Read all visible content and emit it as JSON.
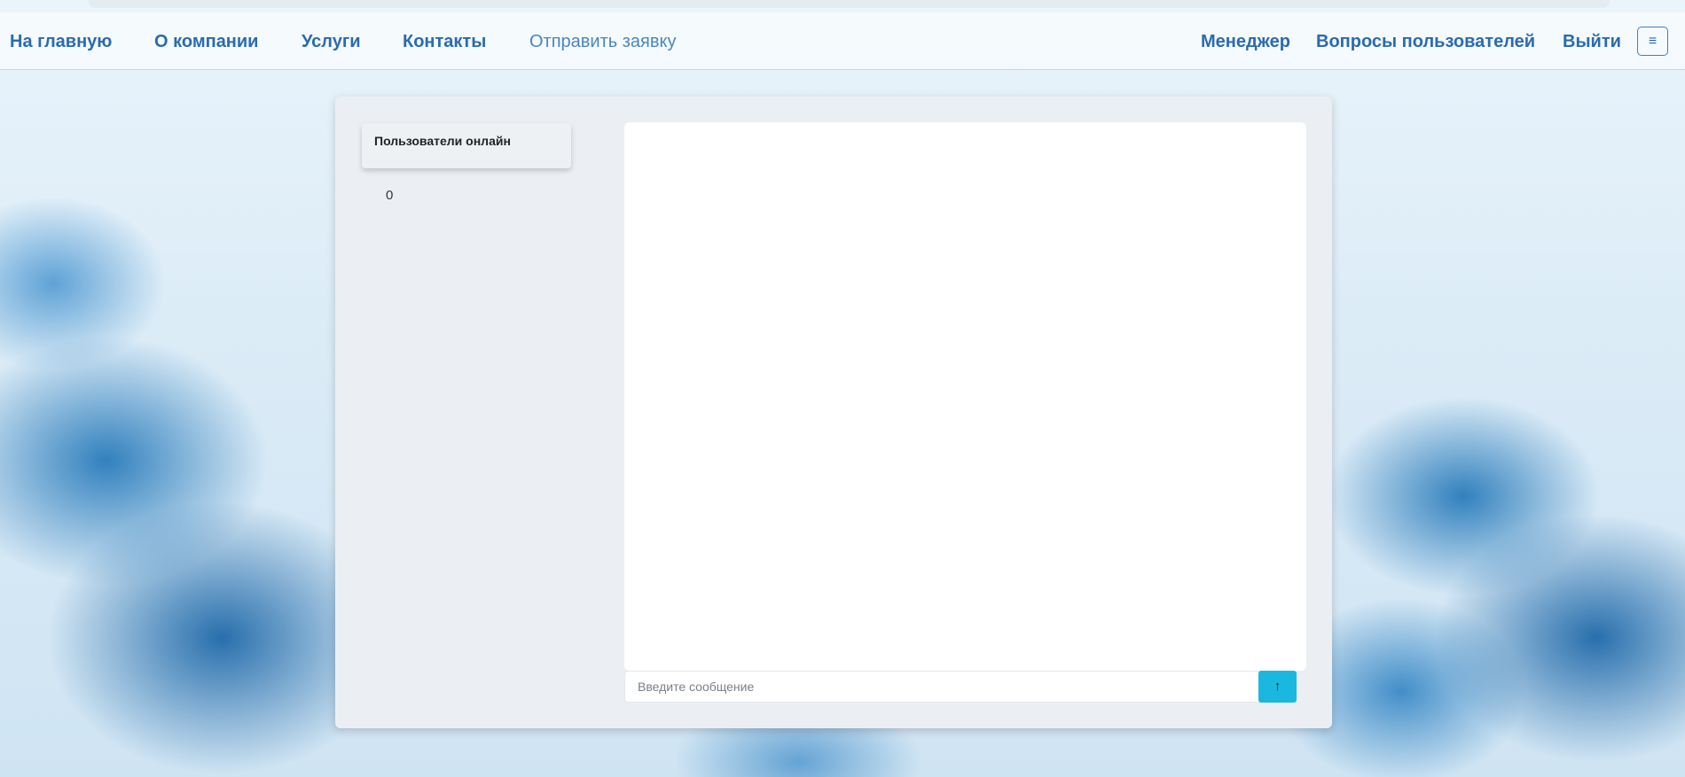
{
  "nav": {
    "home": "На главную",
    "about": "О компании",
    "services": "Услуги",
    "contacts": "Контакты",
    "send_request": "Отправить заявку",
    "manager": "Менеджер",
    "user_questions": "Вопросы пользователей",
    "logout": "Выйти",
    "menu_icon": "hamburger-icon",
    "menu_glyph": "≡"
  },
  "sidebar": {
    "online_title": "Пользователи онлайн",
    "online_count": "0"
  },
  "chat": {
    "placeholder": "Введите сообщение",
    "send_icon": "arrow-up-icon",
    "send_glyph": "↑"
  },
  "colors": {
    "nav_link": "#2a6bb0",
    "send_button": "#1ab8e0",
    "card_background": "#ebeff3"
  }
}
